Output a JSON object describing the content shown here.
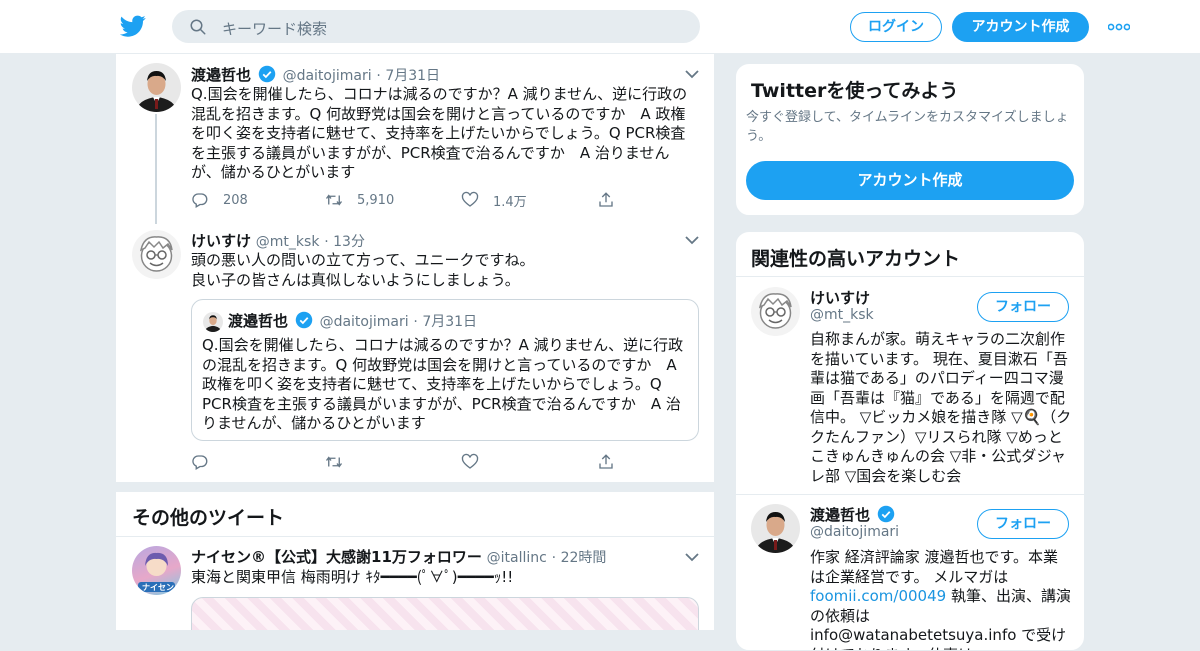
{
  "header": {
    "search_placeholder": "キーワード検索",
    "login_label": "ログイン",
    "signup_label": "アカウント作成",
    "brand_color": "#1da1f2"
  },
  "thread": [
    {
      "name": "渡邉哲也",
      "screen_name": "@daitojimari",
      "time": "7月31日",
      "verified": true,
      "text": "Q.国会を開催したら、コロナは減るのですか？A 減りません、逆に行政の混乱を招きます。Q 何故野党は国会を開けと言っているのですか　A 政権を叩く姿を支持者に魅せて、支持率を上げたいからでしょう。Q PCR検査を主張する議員がいますがが、PCR検査で治るんですか　A 治りませんが、儲かるひとがいます",
      "replies": "208",
      "retweets": "5,910",
      "likes": "1.4万"
    },
    {
      "name": "けいすけ",
      "screen_name": "@mt_ksk",
      "time": "13分",
      "text_line1": "頭の悪い人の問いの立て方って、ユニークですね。",
      "text_line2": "良い子の皆さんは真似しないようにしましょう。",
      "quote": {
        "name": "渡邉哲也",
        "screen_name": "@daitojimari",
        "time": "7月31日",
        "text": "Q.国会を開催したら、コロナは減るのですか？A 減りません、逆に行政の混乱を招きます。Q 何故野党は国会を開けと言っているのですか　A 政権を叩く姿を支持者に魅せて、支持率を上げたいからでしょう。Q PCR検査を主張する議員がいますがが、PCR検査で治るんですか　A 治りませんが、儲かるひとがいます"
      }
    }
  ],
  "other_tweets": {
    "heading": "その他のツイート",
    "tweet": {
      "name": "ナイセン®【公式】大感謝11万フォロワー",
      "screen_name": "@itallinc",
      "time": "22時間",
      "text": "東海と関東甲信 梅雨明け ｷﾀ━━━━(ﾟ∀ﾟ)━━━━ｯ!!",
      "avatar_label": "ナイセン"
    }
  },
  "sidebar": {
    "try_card": {
      "title": "Twitterを使ってみよう",
      "desc": "今すぐ登録して、タイムラインをカスタマイズしましょう。",
      "button": "アカウント作成"
    },
    "related": {
      "title": "関連性の高いアカウント",
      "follow_label": "フォロー",
      "accounts": [
        {
          "name": "けいすけ",
          "screen_name": "@mt_ksk",
          "bio": "自称まんが家。萌えキャラの二次創作を描いています。 現在、夏目漱石「吾輩は猫である」のパロディー四コマ漫画「吾輩は『猫』である」を隔週で配信中。 ▽ビッカメ娘を描き隊 ▽🍳（ククたんファン）▽リスられ隊 ▽めっとこきゅんきゅんの会 ▽非・公式ダジャレ部 ▽国会を楽しむ会"
        },
        {
          "name": "渡邉哲也",
          "screen_name": "@daitojimari",
          "verified": true,
          "bio_pre": "作家 経済評論家 渡邉哲也です。本業は企業経営です。 メルマガは ",
          "bio_link": "foomii.com/00049",
          "bio_post": " 執筆、出演、講演の依頼は info@watanabetetsuya.info で受け付けております。仕事は"
        }
      ]
    }
  }
}
